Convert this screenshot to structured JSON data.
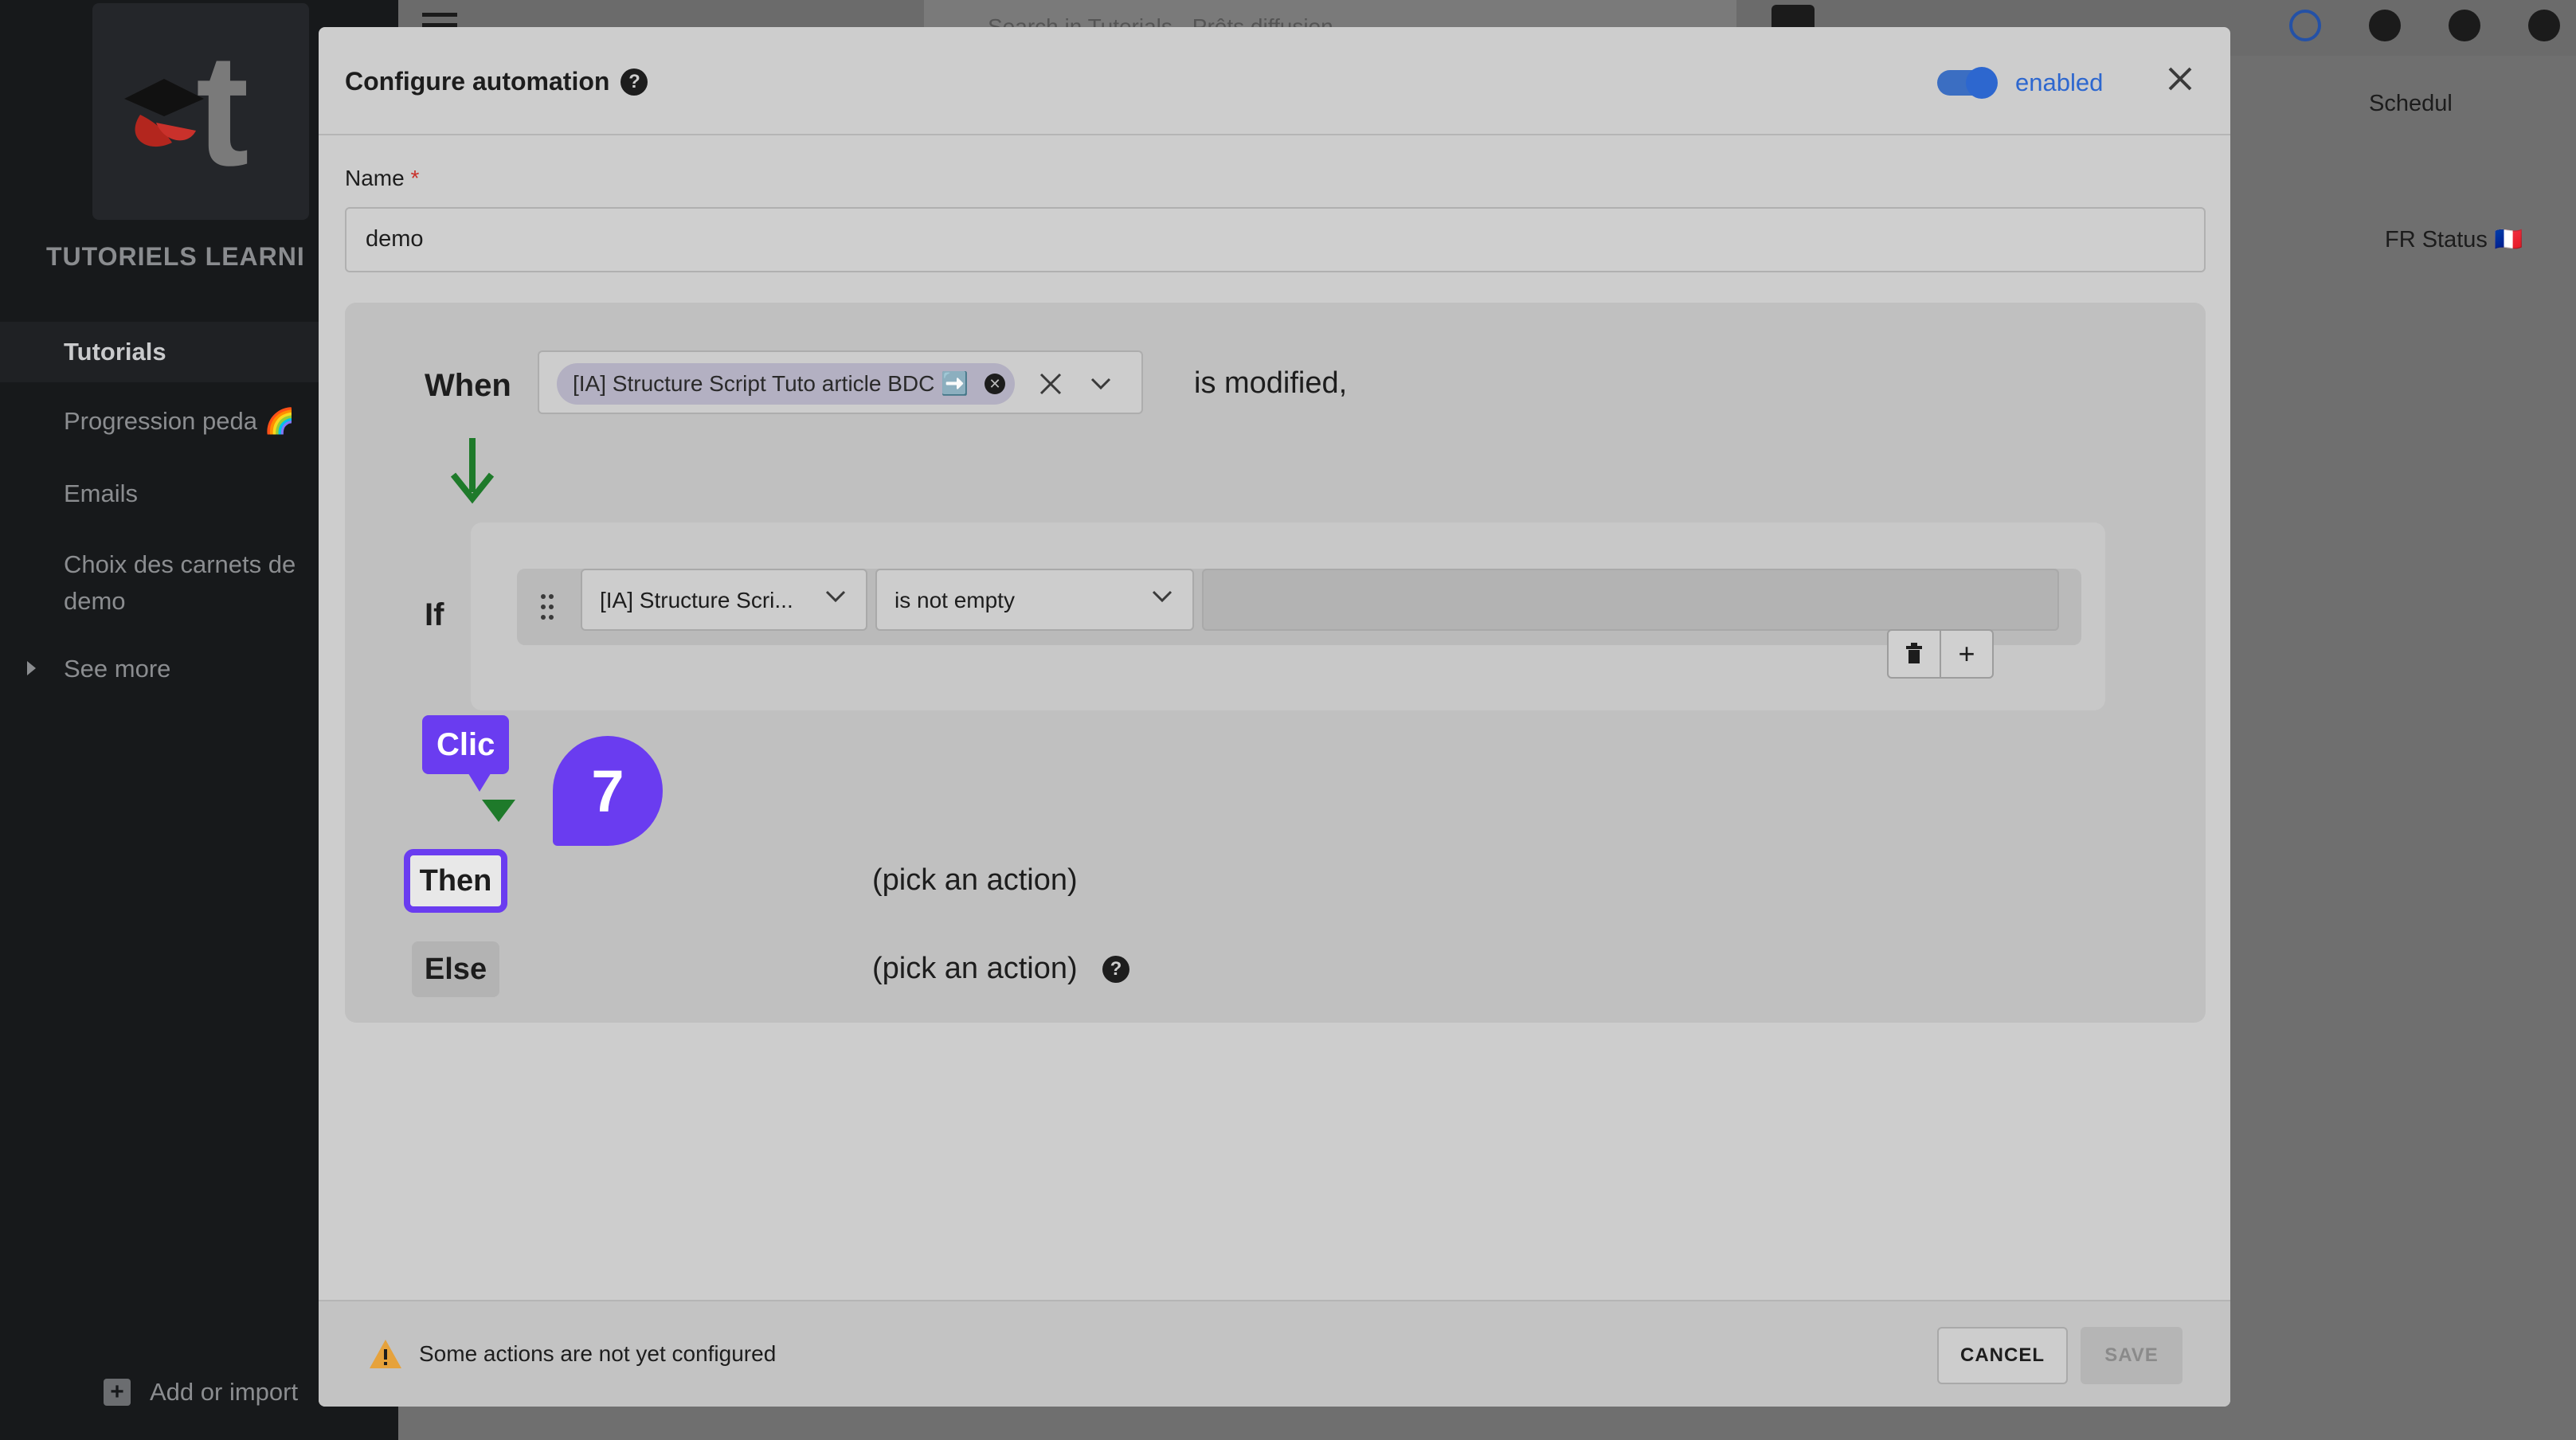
{
  "sidebar": {
    "brand": "TUTORIELS LEARNI",
    "items": [
      {
        "label": "Tutorials"
      },
      {
        "label": "Progression peda 🌈"
      },
      {
        "label": "Emails"
      },
      {
        "label": "Choix des carnets de demo"
      },
      {
        "label": "See more"
      }
    ],
    "add_import": "Add or import"
  },
  "background": {
    "search_placeholder": "Search in Tutorials - Prêts diffusion",
    "tab_schedule": "Schedul",
    "col_fr_status": "FR Status 🇫🇷"
  },
  "modal": {
    "title": "Configure automation",
    "enabled_label": "enabled",
    "name_label": "Name",
    "required_mark": "*",
    "name_value": "demo",
    "when_label": "When",
    "trigger_chip": "[IA] Structure Script Tuto article BDC ➡️",
    "is_modified": "is modified,",
    "if_label": "If",
    "condition_field": "[IA] Structure Scri...",
    "condition_operator": "is not empty",
    "then_label": "Then",
    "else_label": "Else",
    "then_action": "(pick an action)",
    "else_action": "(pick an action)",
    "warning": "Some actions are not yet configured",
    "cancel": "CANCEL",
    "save": "SAVE"
  },
  "overlay": {
    "tooltip": "Clic",
    "step": "7"
  },
  "colors": {
    "accent": "#6a3cf0",
    "toggle": "#2d67cf",
    "arrow": "#1e7a2a",
    "warning": "#e6a23c"
  }
}
